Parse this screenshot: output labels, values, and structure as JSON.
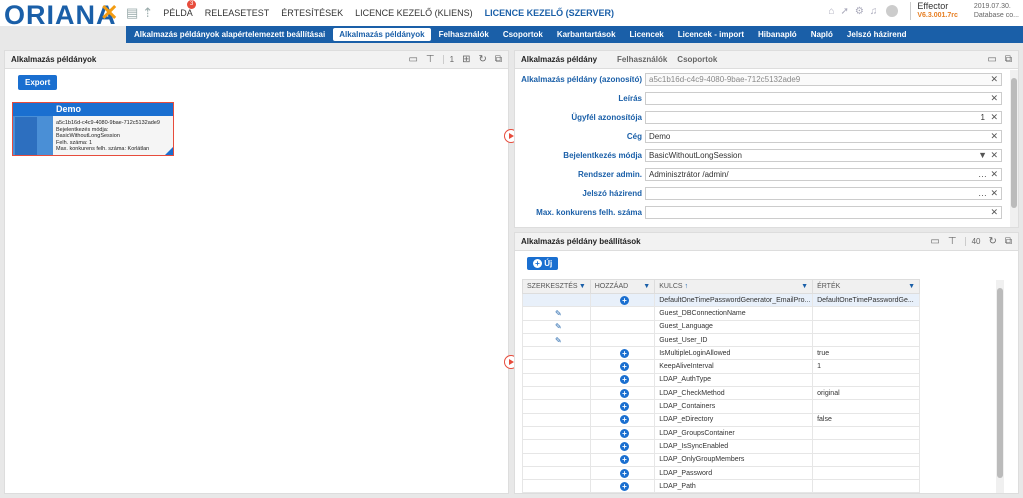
{
  "brand": {
    "logo_text": "ORIANA"
  },
  "topnav": {
    "items": [
      {
        "label": "PÉLDA",
        "badge": "3"
      },
      {
        "label": "RELEASETEST"
      },
      {
        "label": "ÉRTESÍTÉSEK"
      },
      {
        "label": "LICENCE KEZELŐ (KLIENS)"
      },
      {
        "label": "LICENCE KEZELŐ (SZERVER)",
        "active": true
      }
    ]
  },
  "product": {
    "name": "Effector",
    "version": "V6.3.001.7rc",
    "date": "2019.07.30.",
    "db": "Database co..."
  },
  "subnav": {
    "items": [
      "Alkalmazás példányok alapértelemezett beállításai",
      "Alkalmazás példányok",
      "Felhasználók",
      "Csoportok",
      "Karbantartások",
      "Licencek",
      "Licencek - import",
      "Hibanapló",
      "Napló",
      "Jelszó házirend"
    ],
    "active_index": 1
  },
  "left_panel": {
    "title": "Alkalmazás példányok",
    "count": "1",
    "export_label": "Export",
    "card": {
      "title": "Demo",
      "lines": [
        "a5c1b16d-c4c9-4080-9bae-712c5132ade9",
        "Bejelentkezés módja: BasicWithoutLongSession",
        "Felh. száma: 1",
        "Max. konkurens felh. száma: Korlátlan"
      ]
    }
  },
  "detail_panel": {
    "tabs": [
      "Alkalmazás példány",
      "Felhasználók",
      "Csoportok"
    ],
    "fields": [
      {
        "label": "Alkalmazás példány (azonosító)",
        "value": "a5c1b16d-c4c9-4080-9bae-712c5132ade9",
        "readonly": true
      },
      {
        "label": "Leírás",
        "value": ""
      },
      {
        "label": "Ügyfél azonosítója",
        "value": "1",
        "align": "right"
      },
      {
        "label": "Cég",
        "value": "Demo"
      },
      {
        "label": "Bejelentkezés módja",
        "value": "BasicWithoutLongSession",
        "dropdown": true
      },
      {
        "label": "Rendszer admin.",
        "value": "Adminisztrátor /admin/",
        "ellipsis": true
      },
      {
        "label": "Jelszó házirend",
        "value": "",
        "ellipsis": true
      },
      {
        "label": "Max. konkurens felh. száma",
        "value": ""
      }
    ]
  },
  "settings_panel": {
    "title": "Alkalmazás példány beállítások",
    "count": "40",
    "new_label": "Új",
    "columns": [
      "SZERKESZTÉS",
      "HOZZÁAD",
      "KULCS",
      "ÉRTÉK"
    ],
    "rows": [
      {
        "edit": false,
        "add": true,
        "key": "DefaultOneTimePasswordGenerator_EmailPro...",
        "value": "DefaultOneTimePasswordGe..."
      },
      {
        "edit": true,
        "add": false,
        "key": "Guest_DBConnectionName",
        "value": ""
      },
      {
        "edit": true,
        "add": false,
        "key": "Guest_Language",
        "value": ""
      },
      {
        "edit": true,
        "add": false,
        "key": "Guest_User_ID",
        "value": ""
      },
      {
        "edit": false,
        "add": true,
        "key": "IsMultipleLoginAllowed",
        "value": "true"
      },
      {
        "edit": false,
        "add": true,
        "key": "KeepAliveInterval",
        "value": "1"
      },
      {
        "edit": false,
        "add": true,
        "key": "LDAP_AuthType",
        "value": ""
      },
      {
        "edit": false,
        "add": true,
        "key": "LDAP_CheckMethod",
        "value": "original"
      },
      {
        "edit": false,
        "add": true,
        "key": "LDAP_Containers",
        "value": ""
      },
      {
        "edit": false,
        "add": true,
        "key": "LDAP_eDirectory",
        "value": "false"
      },
      {
        "edit": false,
        "add": true,
        "key": "LDAP_GroupsContainer",
        "value": ""
      },
      {
        "edit": false,
        "add": true,
        "key": "LDAP_IsSyncEnabled",
        "value": ""
      },
      {
        "edit": false,
        "add": true,
        "key": "LDAP_OnlyGroupMembers",
        "value": ""
      },
      {
        "edit": false,
        "add": true,
        "key": "LDAP_Password",
        "value": ""
      },
      {
        "edit": false,
        "add": true,
        "key": "LDAP_Path",
        "value": ""
      }
    ]
  },
  "colors": {
    "brand": "#1a5fa8",
    "accent": "#f39c12",
    "danger": "#e74c3c"
  }
}
